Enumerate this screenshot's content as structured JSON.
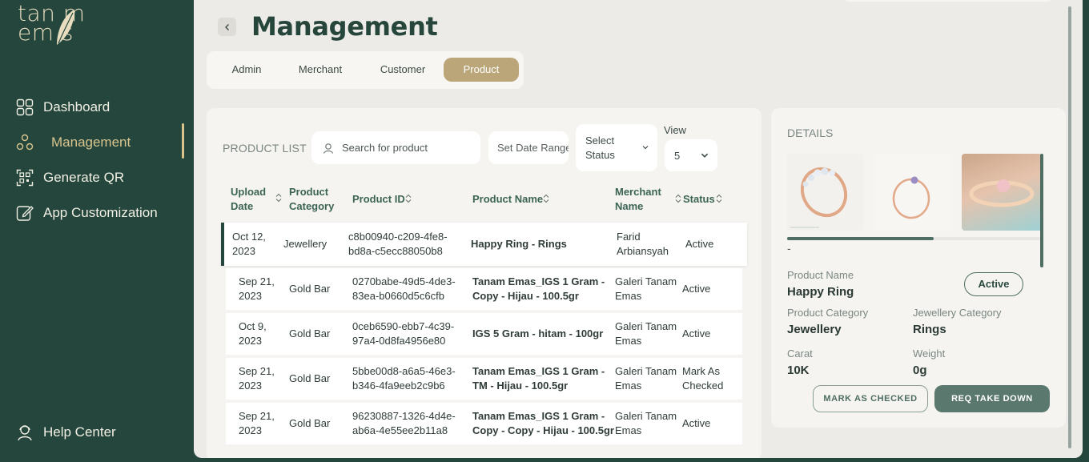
{
  "brand": {
    "line1": "tan m",
    "line2": "em s"
  },
  "sidebar": {
    "items": [
      {
        "label": "Dashboard",
        "icon": "dashboard-grid-icon"
      },
      {
        "label": "Management",
        "icon": "management-nodes-icon"
      },
      {
        "label": "Generate QR",
        "icon": "qr-scan-icon"
      },
      {
        "label": "App Customization",
        "icon": "edit-pencil-icon"
      }
    ],
    "help": {
      "label": "Help Center",
      "icon": "user-headset-icon"
    }
  },
  "header": {
    "title": "Management"
  },
  "tabs": [
    {
      "label": "Admin"
    },
    {
      "label": "Merchant"
    },
    {
      "label": "Customer"
    },
    {
      "label": "Product",
      "active": true
    }
  ],
  "product_list": {
    "title": "PRODUCT LIST",
    "search_placeholder": "Search for product",
    "date_placeholder": "Set Date Range",
    "status_select": "Select Status",
    "view_label": "View",
    "view_value": "5",
    "columns": {
      "upload_date": "Upload Date",
      "category": "Product Category",
      "id": "Product ID",
      "name": "Product Name",
      "merchant": "Merchant Name",
      "status": "Status"
    },
    "rows": [
      {
        "date": "Oct 12, 2023",
        "category": "Jewellery",
        "id": "c8b00940-c209-4fe8-bd8a-c5ecc88050b8",
        "name": "Happy Ring - Rings",
        "merchant": "Farid Arbiansyah",
        "status": "Active"
      },
      {
        "date": "Sep 21, 2023",
        "category": "Gold Bar",
        "id": "0270babe-49d5-4de3-83ea-b0660d5c6cfb",
        "name": "Tanam Emas_IGS 1 Gram - Copy - Hijau - 100.5gr",
        "merchant": "Galeri Tanam Emas",
        "status": "Active"
      },
      {
        "date": "Oct 9, 2023",
        "category": "Gold Bar",
        "id": "0ceb6590-ebb7-4c39-97a4-0d8fa4956e80",
        "name": "IGS 5 Gram - hitam - 100gr",
        "merchant": "Galeri Tanam Emas",
        "status": "Active"
      },
      {
        "date": "Sep 21, 2023",
        "category": "Gold Bar",
        "id": "5bbe00d8-a6a5-46e3-b346-4fa9eeb2c9b6",
        "name": "Tanam Emas_IGS 1 Gram -TM - Hijau - 100.5gr",
        "merchant": "Galeri Tanam Emas",
        "status": "Mark As Checked"
      },
      {
        "date": "Sep 21, 2023",
        "category": "Gold Bar",
        "id": "96230887-1326-4d4e-ab6a-4e55ee2b11a8",
        "name": "Tanam Emas_IGS 1 Gram - Copy - Copy - Hijau - 100.5gr",
        "merchant": "Galeri Tanam Emas",
        "status": "Active"
      }
    ]
  },
  "details": {
    "title": "DETAILS",
    "image_caption": "-",
    "image_scroll_fraction": 0.58,
    "product_name_label": "Product Name",
    "product_name": "Happy Ring",
    "status_badge": "Active",
    "product_category_label": "Product Category",
    "product_category": "Jewellery",
    "jewellery_category_label": "Jewellery Category",
    "jewellery_category": "Rings",
    "carat_label": "Carat",
    "carat": "10K",
    "weight_label": "Weight",
    "weight": "0g",
    "mark_checked_label": "MARK AS CHECKED",
    "req_takedown_label": "REQ TAKE DOWN"
  },
  "colors": {
    "sidebar": "#24463c",
    "accent_gold": "#bba679",
    "primary_green": "#4e6d63"
  }
}
